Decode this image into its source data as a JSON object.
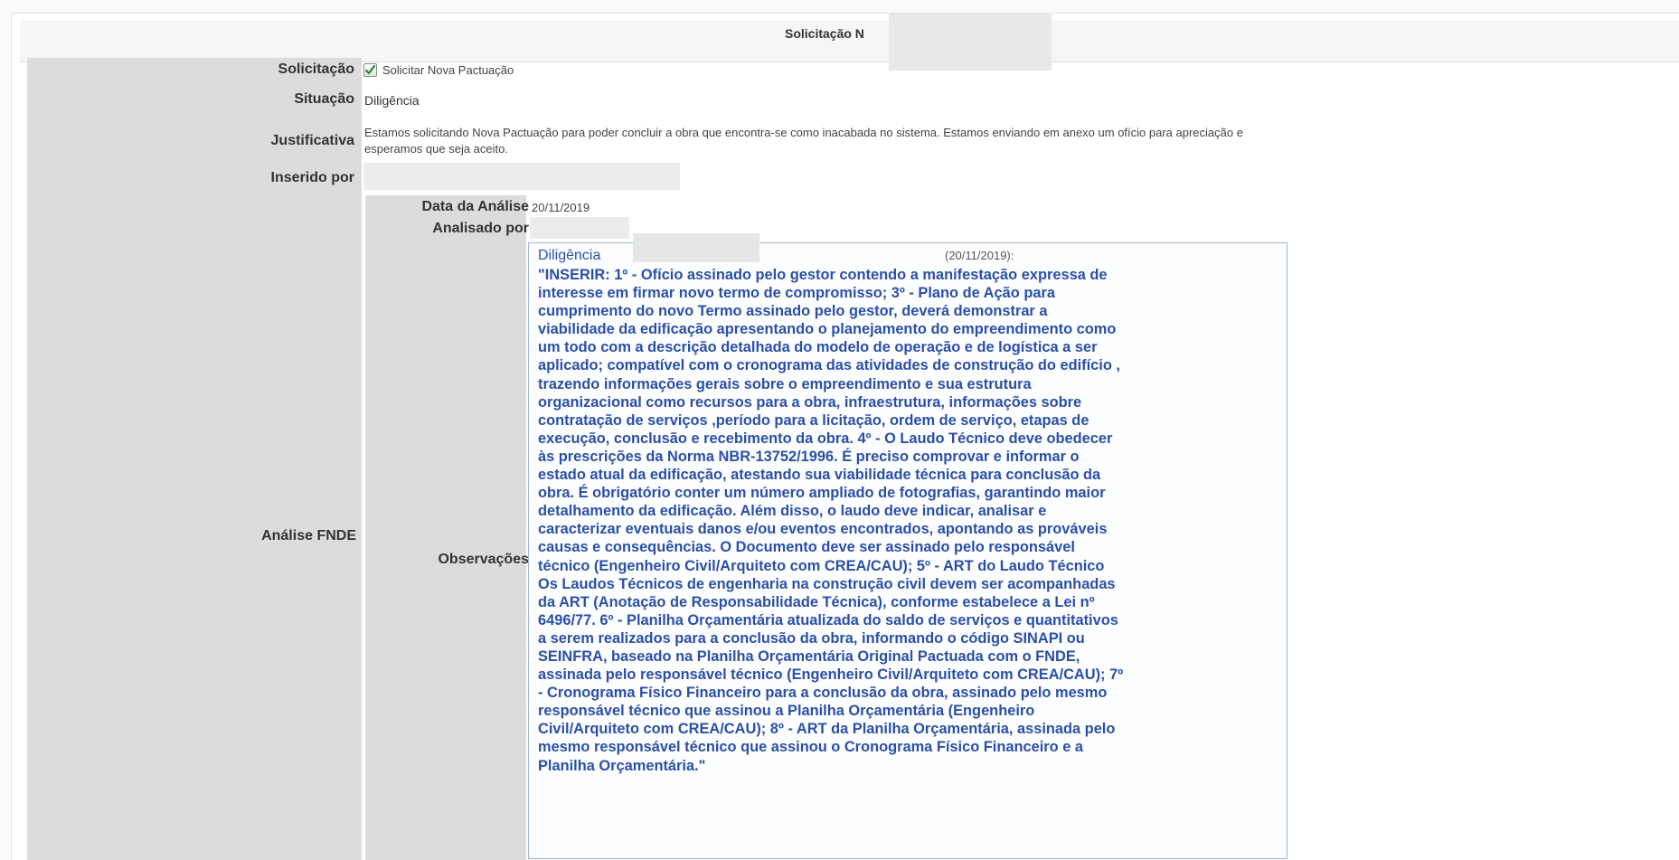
{
  "header": {
    "title": "Solicitação N"
  },
  "fields": {
    "solicitacao_label": "Solicitação",
    "solicitacao_option": "Solicitar Nova Pactuação",
    "solicitacao_checked": true,
    "situacao_label": "Situação",
    "situacao_value": "Diligência",
    "justificativa_label": "Justificativa",
    "justificativa_line1": "Estamos solicitando Nova Pactuação para poder concluir a obra que encontra-se como inacabada no sistema. Estamos enviando em anexo um ofício para apreciação e",
    "justificativa_line2": "esperamos que seja aceito.",
    "inserido_label": "Inserido por"
  },
  "analise": {
    "section_label": "Análise FNDE",
    "data_label": "Data da Análise",
    "data_value": "20/11/2019",
    "analisado_label": "Analisado por",
    "observacoes_label": "Observações",
    "obs_status": "Diligência",
    "obs_date": "(20/11/2019):",
    "obs_text": "\"INSERIR: 1º - Ofício assinado pelo gestor contendo a manifestação expressa de\ninteresse em firmar novo termo de compromisso; 3º - Plano de Ação para\ncumprimento do novo Termo assinado pelo gestor, deverá demonstrar a\nviabilidade da edificação apresentando o planejamento do empreendimento como\num todo com a descrição detalhada do modelo de operação e de logística a ser\naplicado; compatível com o cronograma das atividades de construção do edifício ,\ntrazendo informações gerais sobre o empreendimento e sua estrutura\norganizacional como recursos para a obra, infraestrutura, informações sobre\ncontratação de serviços ,período para a licitação, ordem de serviço, etapas de\nexecução, conclusão e recebimento da obra. 4º - O Laudo Técnico deve obedecer\nàs prescrições da Norma NBR-13752/1996. É preciso comprovar e informar o\nestado atual da edificação, atestando sua viabilidade técnica para conclusão da\nobra. É obrigatório conter um número ampliado de fotografias, garantindo maior\ndetalhamento da edificação. Além disso, o laudo deve indicar, analisar e\ncaracterizar eventuais danos e/ou eventos encontrados, apontando as prováveis\ncausas e consequências. O Documento deve ser assinado pelo responsável\ntécnico (Engenheiro Civil/Arquiteto com CREA/CAU); 5º - ART do Laudo Técnico\nOs Laudos Técnicos de engenharia na construção civil devem ser acompanhadas\nda ART (Anotação de Responsabilidade Técnica), conforme estabelece a Lei nº\n6496/77. 6º - Planilha Orçamentária atualizada do saldo de serviços e quantitativos\na serem realizados para a conclusão da obra, informando o código SINAPI ou\nSEINFRA, baseado na Planilha Orçamentária Original Pactuada com o FNDE,\nassinada pelo responsável técnico (Engenheiro Civil/Arquiteto com CREA/CAU); 7º\n- Cronograma Físico Financeiro para a conclusão da obra, assinado pelo mesmo\nresponsável técnico que assinou a Planilha Orçamentária (Engenheiro\nCivil/Arquiteto com CREA/CAU); 8º - ART da Planilha Orçamentária, assinada pelo\nmesmo responsável técnico que assinou o Cronograma Físico Financeiro e a\nPlanilha Orçamentária.\""
  },
  "colors": {
    "label_bg": "#dcdcdc",
    "obs_text": "#2a4fa8",
    "obs_border": "#9db4d8",
    "checkmark": "#1f8a2a"
  }
}
